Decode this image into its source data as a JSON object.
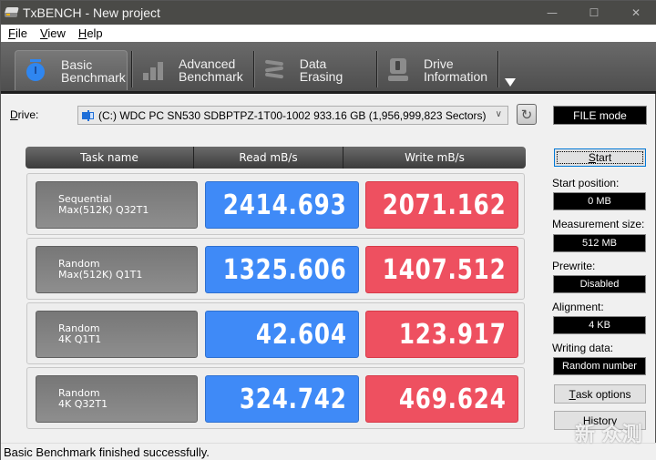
{
  "window": {
    "title": "TxBENCH - New project",
    "controls": {
      "minimize": "—",
      "maximize": "☐",
      "close": "✕"
    }
  },
  "menu": {
    "items": [
      {
        "label": "File",
        "accel": "F",
        "rest": "ile"
      },
      {
        "label": "View",
        "accel": "V",
        "rest": "iew"
      },
      {
        "label": "Help",
        "accel": "H",
        "rest": "elp"
      }
    ]
  },
  "toolbar": {
    "tabs": [
      {
        "line1": "Basic",
        "line2": "Benchmark",
        "icon": "stopwatch-icon",
        "active": true
      },
      {
        "line1": "Advanced",
        "line2": "Benchmark",
        "icon": "bar-chart-icon",
        "active": false
      },
      {
        "line1": "Data Erasing",
        "line2": "",
        "icon": "spring-icon",
        "active": false
      },
      {
        "line1": "Drive",
        "line2": "Information",
        "icon": "drive-info-icon",
        "active": false
      }
    ],
    "more_icon": "▼"
  },
  "drive": {
    "label": "Drive:",
    "selected": "(C:) WDC PC SN530 SDBPTPZ-1T00-1002  933.16 GB (1,956,999,823 Sectors)",
    "refresh_icon": "↻",
    "mode": "FILE mode"
  },
  "table": {
    "headers": {
      "task": "Task name",
      "read": "Read mB/s",
      "write": "Write mB/s"
    },
    "rows": [
      {
        "task_line1": "Sequential",
        "task_line2": "Max(512K) Q32T1",
        "read": "2414.693",
        "write": "2071.162"
      },
      {
        "task_line1": "Random",
        "task_line2": "Max(512K) Q1T1",
        "read": "1325.606",
        "write": "1407.512"
      },
      {
        "task_line1": "Random",
        "task_line2": "4K Q1T1",
        "read": "42.604",
        "write": "123.917"
      },
      {
        "task_line1": "Random",
        "task_line2": "4K Q32T1",
        "read": "324.742",
        "write": "469.624"
      }
    ]
  },
  "colors": {
    "read": "#3f8af7",
    "write": "#ee5060",
    "task": "#808080"
  },
  "panel": {
    "start": {
      "accel": "S",
      "rest": "tart"
    },
    "start_position_label": "Start position:",
    "start_position": "0 MB",
    "measurement_size_label": "Measurement size:",
    "measurement_size": "512 MB",
    "prewrite_label": "Prewrite:",
    "prewrite": "Disabled",
    "alignment_label": "Alignment:",
    "alignment": "4 KB",
    "writing_data_label": "Writing data:",
    "writing_data": "Random number",
    "task_options": {
      "accel": "T",
      "rest": "ask options"
    },
    "history": "History"
  },
  "status": {
    "message": "Basic Benchmark finished successfully."
  },
  "watermark": "新 众测"
}
